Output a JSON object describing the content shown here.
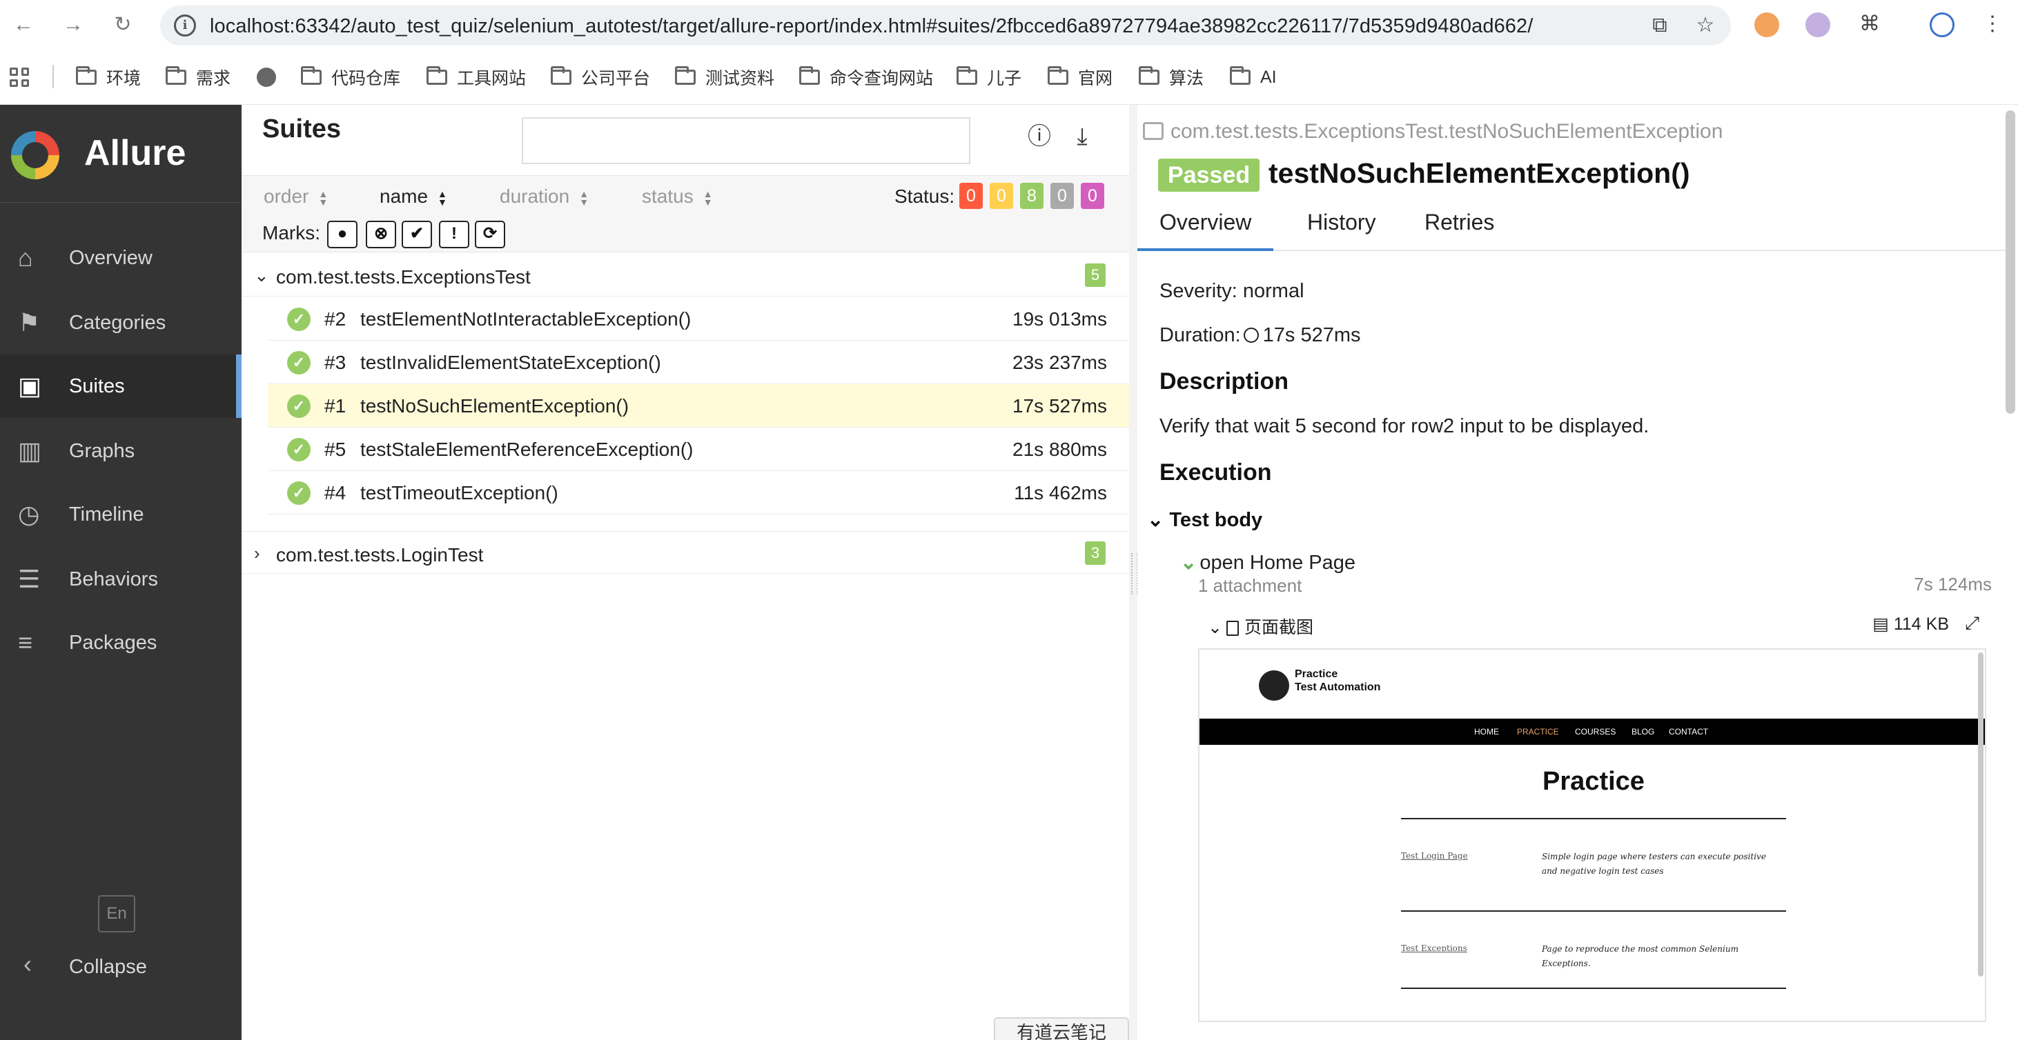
{
  "browser": {
    "url": "localhost:63342/auto_test_quiz/selenium_autotest/target/allure-report/index.html#suites/2fbcced6a89727794ae38982cc226117/7d5359d9480ad662/"
  },
  "bookmarks": [
    "环境",
    "需求",
    "代码仓库",
    "工具网站",
    "公司平台",
    "测试资料",
    "命令查询网站",
    "儿子",
    "官网",
    "算法",
    "AI"
  ],
  "sidebar": {
    "brand": "Allure",
    "items": [
      {
        "label": "Overview",
        "icon": "home-icon"
      },
      {
        "label": "Categories",
        "icon": "flag-icon"
      },
      {
        "label": "Suites",
        "icon": "briefcase-icon"
      },
      {
        "label": "Graphs",
        "icon": "bar-chart-icon"
      },
      {
        "label": "Timeline",
        "icon": "clock-icon"
      },
      {
        "label": "Behaviors",
        "icon": "list-icon"
      },
      {
        "label": "Packages",
        "icon": "align-left-icon"
      }
    ],
    "active": "Suites",
    "lang": "En",
    "collapse": "Collapse"
  },
  "suites": {
    "title": "Suites",
    "sort": {
      "order": "order",
      "name": "name",
      "duration": "duration",
      "status": "status"
    },
    "status_label": "Status:",
    "status_counts": [
      {
        "value": "0",
        "color": "#fd5a3e"
      },
      {
        "value": "0",
        "color": "#ffd050"
      },
      {
        "value": "8",
        "color": "#97cc64"
      },
      {
        "value": "0",
        "color": "#aaaaaa"
      },
      {
        "value": "0",
        "color": "#d35ebe"
      }
    ],
    "marks_label": "Marks:",
    "groups": [
      {
        "name": "com.test.tests.ExceptionsTest",
        "count": "5",
        "expanded": true,
        "rows": [
          {
            "num": "#2",
            "name": "testElementNotInteractableException()",
            "duration": "19s 013ms"
          },
          {
            "num": "#3",
            "name": "testInvalidElementStateException()",
            "duration": "23s 237ms"
          },
          {
            "num": "#1",
            "name": "testNoSuchElementException()",
            "duration": "17s 527ms",
            "selected": true
          },
          {
            "num": "#5",
            "name": "testStaleElementReferenceException()",
            "duration": "21s 880ms"
          },
          {
            "num": "#4",
            "name": "testTimeoutException()",
            "duration": "11s 462ms"
          }
        ]
      },
      {
        "name": "com.test.tests.LoginTest",
        "count": "3",
        "expanded": false
      }
    ],
    "note_tab": "有道云笔记"
  },
  "result": {
    "breadcrumb": "com.test.tests.ExceptionsTest.testNoSuchElementException",
    "status": "Passed",
    "title": "testNoSuchElementException()",
    "tabs": [
      "Overview",
      "History",
      "Retries"
    ],
    "severity": "Severity: normal",
    "duration_label": "Duration:",
    "duration": "17s 527ms",
    "description_heading": "Description",
    "description": "Verify that wait 5 second for row2 input to be displayed.",
    "execution_heading": "Execution",
    "test_body": "Test body",
    "step": {
      "name": "open Home Page",
      "attachments": "1 attachment",
      "duration": "7s 124ms",
      "attachment_name": "页面截图",
      "attachment_size": "114 KB"
    },
    "screenshot": {
      "brand_line1": "Practice",
      "brand_line2": "Test Automation",
      "nav": [
        "HOME",
        "PRACTICE",
        "COURSES",
        "BLOG",
        "CONTACT"
      ],
      "heading": "Practice",
      "link1": "Test Login Page",
      "desc1": "Simple login page where testers can execute positive and negative login test cases",
      "link2": "Test Exceptions",
      "desc2": "Page to reproduce the most common Selenium Exceptions."
    }
  }
}
